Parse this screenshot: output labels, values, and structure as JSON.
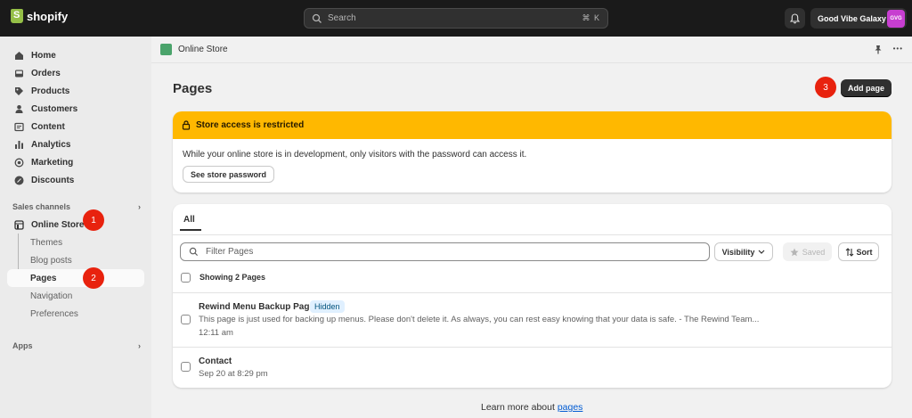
{
  "topbar": {
    "brand": "shopify",
    "search_placeholder": "Search",
    "search_shortcut": "⌘ K",
    "store_name": "Good Vibe Galaxy",
    "avatar_initials": "GVG"
  },
  "sidebar": {
    "items": [
      {
        "label": "Home",
        "icon": "home-icon"
      },
      {
        "label": "Orders",
        "icon": "inbox-icon"
      },
      {
        "label": "Products",
        "icon": "tag-icon"
      },
      {
        "label": "Customers",
        "icon": "person-icon"
      },
      {
        "label": "Content",
        "icon": "content-icon"
      },
      {
        "label": "Analytics",
        "icon": "bar-chart-icon"
      },
      {
        "label": "Marketing",
        "icon": "target-icon"
      },
      {
        "label": "Discounts",
        "icon": "discount-icon"
      }
    ],
    "sales_channels_heading": "Sales channels",
    "online_store_label": "Online Store",
    "sub_items": [
      {
        "label": "Themes"
      },
      {
        "label": "Blog posts"
      },
      {
        "label": "Pages"
      },
      {
        "label": "Navigation"
      },
      {
        "label": "Preferences"
      }
    ],
    "apps_heading": "Apps",
    "arrow": "›"
  },
  "badges": {
    "one": "1",
    "two": "2",
    "three": "3"
  },
  "breadcrumb": {
    "label": "Online Store",
    "pin_icon": "pin-icon",
    "more_icon": "more-icon",
    "more": "•••"
  },
  "page": {
    "title": "Pages",
    "add_button": "Add page"
  },
  "banner": {
    "title": "Store access is restricted",
    "text": "While your online store is in development, only visitors with the password can access it.",
    "button": "See store password",
    "color": "#ffb800"
  },
  "list": {
    "tab_all": "All",
    "filter_placeholder": "Filter Pages",
    "visibility_button": "Visibility",
    "saved_button": "Saved",
    "sort_button": "Sort",
    "showing": "Showing 2 Pages",
    "rows": [
      {
        "title": "Rewind Menu Backup Page",
        "tag": "Hidden",
        "description": "This page is just used for backing up menus. Please don't delete it. As always, you can rest easy knowing that your data is safe. - The Rewind Team...",
        "time": "12:11 am"
      },
      {
        "title": "Contact",
        "time": "Sep 20 at 8:29 pm"
      }
    ]
  },
  "footer": {
    "text": "Learn more about ",
    "link": "pages"
  }
}
